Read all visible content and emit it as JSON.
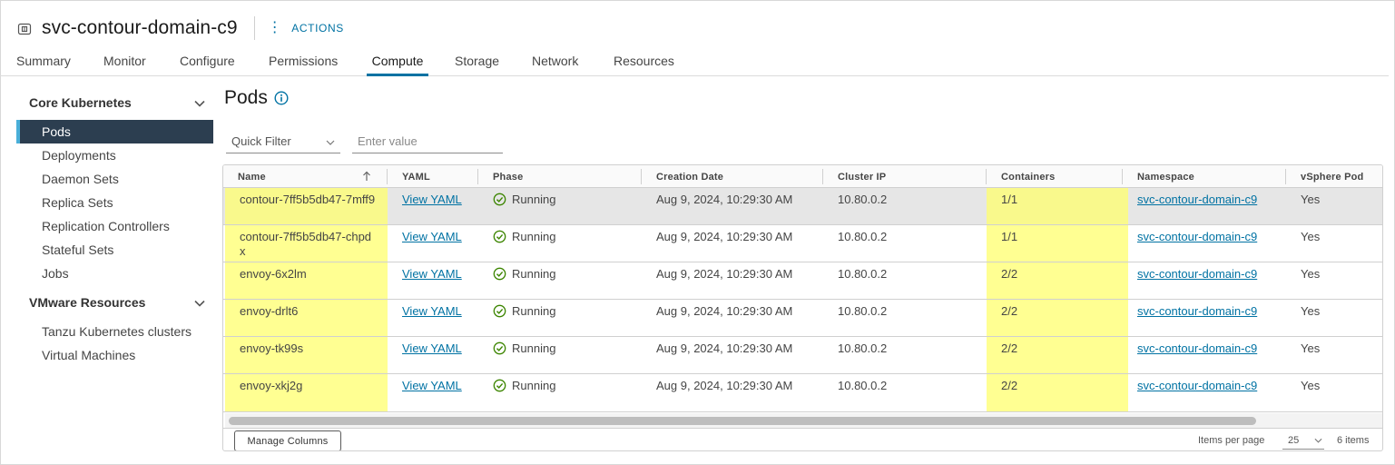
{
  "header": {
    "title": "svc-contour-domain-c9",
    "actions_label": "ACTIONS",
    "object_icon": "vm-service-icon"
  },
  "tabs": [
    {
      "label": "Summary"
    },
    {
      "label": "Monitor"
    },
    {
      "label": "Configure"
    },
    {
      "label": "Permissions"
    },
    {
      "label": "Compute",
      "active": true
    },
    {
      "label": "Storage"
    },
    {
      "label": "Network"
    },
    {
      "label": "Resources"
    }
  ],
  "sidebar": {
    "core_section": "Core Kubernetes",
    "core_items": [
      "Pods",
      "Deployments",
      "Daemon Sets",
      "Replica Sets",
      "Replication Controllers",
      "Stateful Sets",
      "Jobs"
    ],
    "active_item": "Pods",
    "vmware_section": "VMware Resources",
    "vmware_items": [
      "Tanzu Kubernetes clusters",
      "Virtual Machines"
    ]
  },
  "main": {
    "title": "Pods",
    "filter": {
      "quick_filter_label": "Quick Filter",
      "placeholder": "Enter value"
    },
    "grid": {
      "columns": [
        "Name",
        "YAML",
        "Phase",
        "Creation Date",
        "Cluster IP",
        "Containers",
        "Namespace",
        "vSphere Pod"
      ],
      "rows": [
        {
          "name": "contour-7ff5b5db47-7mff9",
          "yaml": "View YAML",
          "phase": "Running",
          "created": "Aug 9, 2024, 10:29:30 AM",
          "ip": "10.80.0.2",
          "containers": "1/1",
          "namespace": "svc-contour-domain-c9",
          "vsphere_pod": "Yes",
          "selected": true
        },
        {
          "name": "contour-7ff5b5db47-chpdx",
          "yaml": "View YAML",
          "phase": "Running",
          "created": "Aug 9, 2024, 10:29:30 AM",
          "ip": "10.80.0.2",
          "containers": "1/1",
          "namespace": "svc-contour-domain-c9",
          "vsphere_pod": "Yes"
        },
        {
          "name": "envoy-6x2lm",
          "yaml": "View YAML",
          "phase": "Running",
          "created": "Aug 9, 2024, 10:29:30 AM",
          "ip": "10.80.0.2",
          "containers": "2/2",
          "namespace": "svc-contour-domain-c9",
          "vsphere_pod": "Yes"
        },
        {
          "name": "envoy-drlt6",
          "yaml": "View YAML",
          "phase": "Running",
          "created": "Aug 9, 2024, 10:29:30 AM",
          "ip": "10.80.0.2",
          "containers": "2/2",
          "namespace": "svc-contour-domain-c9",
          "vsphere_pod": "Yes"
        },
        {
          "name": "envoy-tk99s",
          "yaml": "View YAML",
          "phase": "Running",
          "created": "Aug 9, 2024, 10:29:30 AM",
          "ip": "10.80.0.2",
          "containers": "2/2",
          "namespace": "svc-contour-domain-c9",
          "vsphere_pod": "Yes"
        },
        {
          "name": "envoy-xkj2g",
          "yaml": "View YAML",
          "phase": "Running",
          "created": "Aug 9, 2024, 10:29:30 AM",
          "ip": "10.80.0.2",
          "containers": "2/2",
          "namespace": "svc-contour-domain-c9",
          "vsphere_pod": "Yes"
        }
      ]
    },
    "footer": {
      "manage_columns": "Manage Columns",
      "items_per_page_label": "Items per page",
      "items_per_page": "25",
      "count": "6 items"
    }
  },
  "colors": {
    "accent": "#0072a3",
    "sidebar_active_bg": "#2c3e50",
    "highlight": "#ffff6e",
    "success": "#3c8500"
  }
}
